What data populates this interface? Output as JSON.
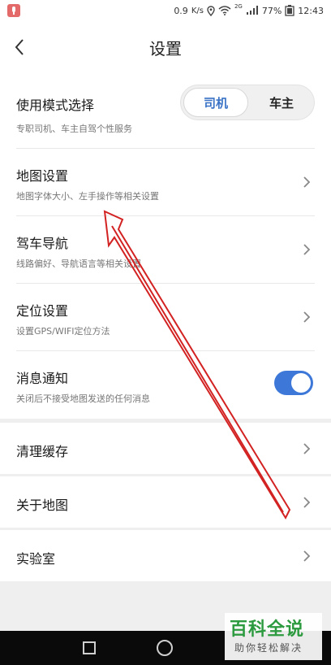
{
  "status_bar": {
    "speed_value": "0.9",
    "speed_unit": "K/s",
    "network_label": "2G",
    "battery": "77%",
    "time": "12:43"
  },
  "header": {
    "title": "设置"
  },
  "mode": {
    "title": "使用模式选择",
    "subtitle": "专职司机、车主自驾个性服务",
    "options": [
      "司机",
      "车主"
    ],
    "selected": "司机"
  },
  "map_settings": {
    "title": "地图设置",
    "subtitle": "地图字体大小、左手操作等相关设置"
  },
  "driving_nav": {
    "title": "驾车导航",
    "subtitle": "线路偏好、导航语言等相关设置"
  },
  "location": {
    "title": "定位设置",
    "subtitle": "设置GPS/WIFI定位方法"
  },
  "notifications": {
    "title": "消息通知",
    "subtitle": "关闭后不接受地图发送的任何消息",
    "enabled": true
  },
  "clear_cache": {
    "title": "清理缓存"
  },
  "about": {
    "title": "关于地图"
  },
  "lab": {
    "title": "实验室"
  },
  "watermark": {
    "title": "百科全说",
    "subtitle": "助你轻松解决"
  },
  "colors": {
    "accent": "#3d78d8",
    "annotation_arrow": "#d32222",
    "watermark_green": "#2c9a3e"
  }
}
